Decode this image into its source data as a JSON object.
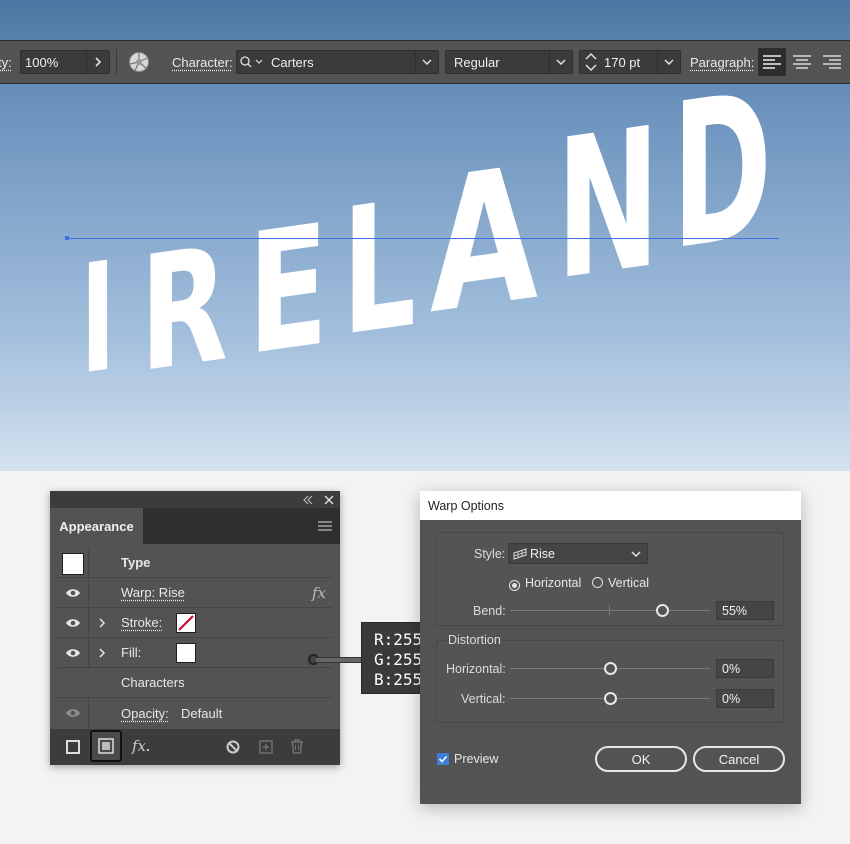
{
  "toolbar": {
    "opacity_label": "ty:",
    "opacity_value": "100%",
    "character_label": "Character:",
    "font_family": "Carters",
    "font_style": "Regular",
    "font_size": "170 pt",
    "paragraph_label": "Paragraph:"
  },
  "canvas": {
    "letters": [
      "I",
      "R",
      "E",
      "L",
      "A",
      "N",
      "D"
    ]
  },
  "appearance": {
    "tab_label": "Appearance",
    "rows": {
      "type": "Type",
      "warp_label": "Warp: Rise",
      "stroke_label": "Stroke:",
      "fill_label": "Fill:",
      "characters": "Characters",
      "opacity_label": "Opacity:",
      "opacity_value": "Default"
    },
    "fx": "fx"
  },
  "tooltip": {
    "r": "R:255",
    "g": "G:255",
    "b": "B:255"
  },
  "warp": {
    "title": "Warp Options",
    "style_label": "Style:",
    "style_value": "Rise",
    "horizontal_radio": "Horizontal",
    "vertical_radio": "Vertical",
    "orientation_selected": "horizontal",
    "bend_label": "Bend:",
    "bend_value": "55%",
    "distortion_label": "Distortion",
    "dist_horizontal_label": "Horizontal:",
    "dist_horizontal_value": "0%",
    "dist_vertical_label": "Vertical:",
    "dist_vertical_value": "0%",
    "preview_label": "Preview",
    "preview_checked": true,
    "ok_label": "OK",
    "cancel_label": "Cancel"
  },
  "colors": {
    "accent_check": "#3d7fd6",
    "stroke_none": "#c8102e",
    "guide": "#3f6fe0"
  }
}
